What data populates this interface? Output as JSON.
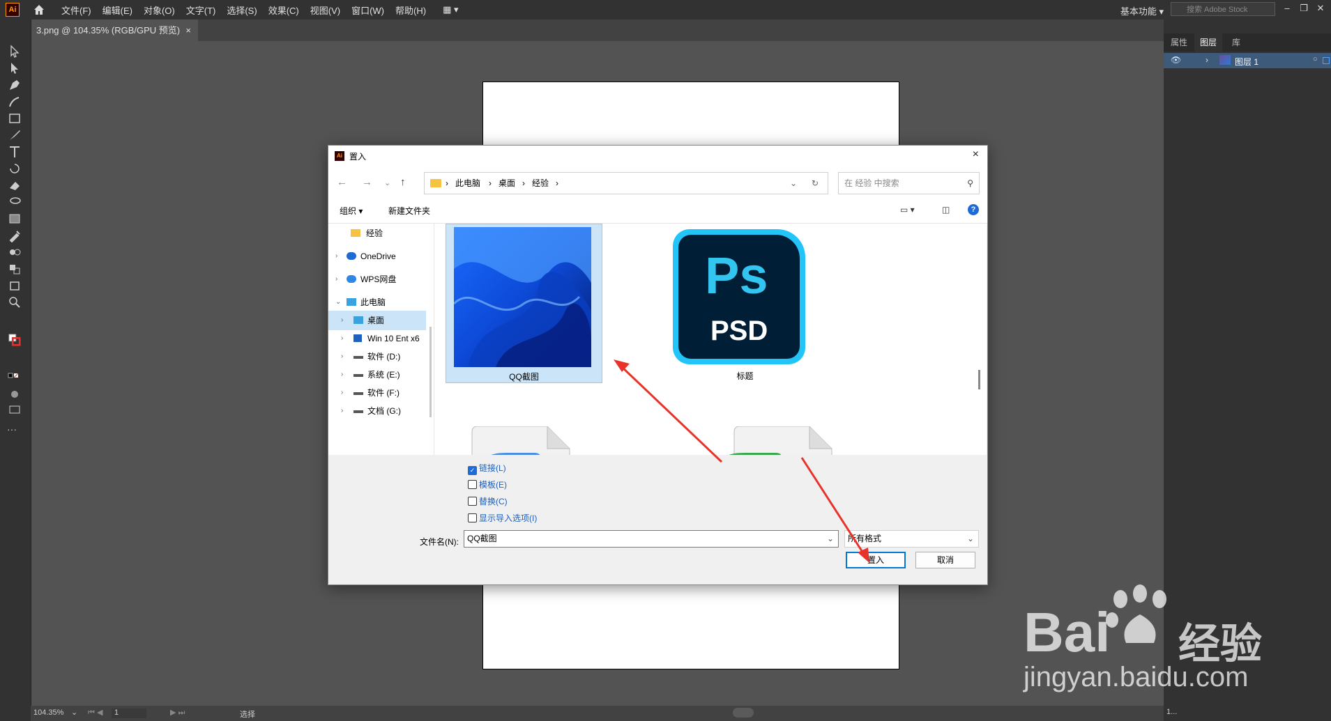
{
  "app": {
    "logo": "Ai",
    "menus": [
      "文件(F)",
      "编辑(E)",
      "对象(O)",
      "文字(T)",
      "选择(S)",
      "效果(C)",
      "视图(V)",
      "窗口(W)",
      "帮助(H)"
    ],
    "workspace": "基本功能",
    "stock_search_placeholder": "搜索 Adobe Stock",
    "doc_tab": "3.png @ 104.35% (RGB/GPU 预览)",
    "doc_tab_close": "×"
  },
  "panel": {
    "tabs": [
      "属性",
      "图层",
      "库"
    ],
    "active_tab": "图层",
    "layer_name": "图层 1"
  },
  "status": {
    "zoom": "104.35%",
    "artboard": "1",
    "tool": "选择",
    "layers_count": "1..."
  },
  "dialog": {
    "title": "置入",
    "close": "×",
    "breadcrumb": [
      "此电脑",
      "桌面",
      "经验"
    ],
    "search_placeholder": "在 经验 中搜索",
    "commands": {
      "organize": "组织 ▾",
      "new_folder": "新建文件夹"
    },
    "nav_items": [
      {
        "label": "经验",
        "icon": "folder-icon"
      },
      {
        "label": "OneDrive",
        "icon": "cloud-icon"
      },
      {
        "label": "WPS网盘",
        "icon": "cloud-icon"
      },
      {
        "label": "此电脑",
        "icon": "computer-icon"
      },
      {
        "label": "桌面",
        "icon": "desktop-icon"
      },
      {
        "label": "Win 10 Ent x6",
        "icon": "windows-icon"
      },
      {
        "label": "软件 (D:)",
        "icon": "drive-icon"
      },
      {
        "label": "系统 (E:)",
        "icon": "drive-icon"
      },
      {
        "label": "软件 (F:)",
        "icon": "drive-icon"
      },
      {
        "label": "文档 (G:)",
        "icon": "drive-icon"
      }
    ],
    "files": [
      {
        "name": "QQ截图",
        "selected": true
      },
      {
        "name": "标题",
        "selected": false
      }
    ],
    "ps_icon": {
      "big": "Ps",
      "small": "PSD"
    },
    "options": [
      {
        "label": "链接(L)",
        "checked": true
      },
      {
        "label": "模板(E)",
        "checked": false
      },
      {
        "label": "替换(C)",
        "checked": false
      },
      {
        "label": "显示导入选项(I)",
        "checked": false
      }
    ],
    "filename_label": "文件名(N):",
    "filename_value": "QQ截图",
    "filetype_value": "所有格式",
    "place_button": "置入",
    "cancel_button": "取消"
  },
  "watermark": {
    "brand": "Bai",
    "brand2": "经验",
    "url": "jingyan.baidu.com"
  },
  "colors": {
    "accent": "#0078d4",
    "ui_dark": "#323232",
    "canvas": "#535353",
    "arrow": "#e8332a"
  }
}
